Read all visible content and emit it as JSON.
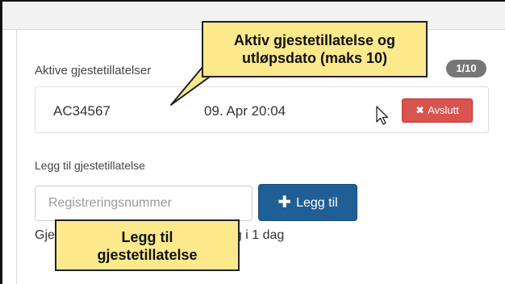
{
  "section_active": {
    "title": "Aktive gjestetillatelser",
    "count_badge": "1/10"
  },
  "permits": [
    {
      "plate": "AC34567",
      "expiry": "09. Apr 20:04",
      "end_button": "Avslutt",
      "end_icon": "times-icon"
    }
  ],
  "add_section": {
    "title": "Legg til gjestetillatelse",
    "input_placeholder": "Registreringsnummer",
    "add_button": "Legg til",
    "help_visible_start": "Gje",
    "help_visible_end": "yldig i 1 dag"
  },
  "callouts": {
    "top_line1": "Aktiv gjestetillatelse og",
    "top_line2": "utløpsdato (maks 10)",
    "bottom_line1": "Legg til",
    "bottom_line2": "gjestetillatelse"
  },
  "colors": {
    "danger": "#d9534f",
    "primary": "#1f5f96",
    "badge": "#777777",
    "callout_fill": "#fbe98c"
  }
}
